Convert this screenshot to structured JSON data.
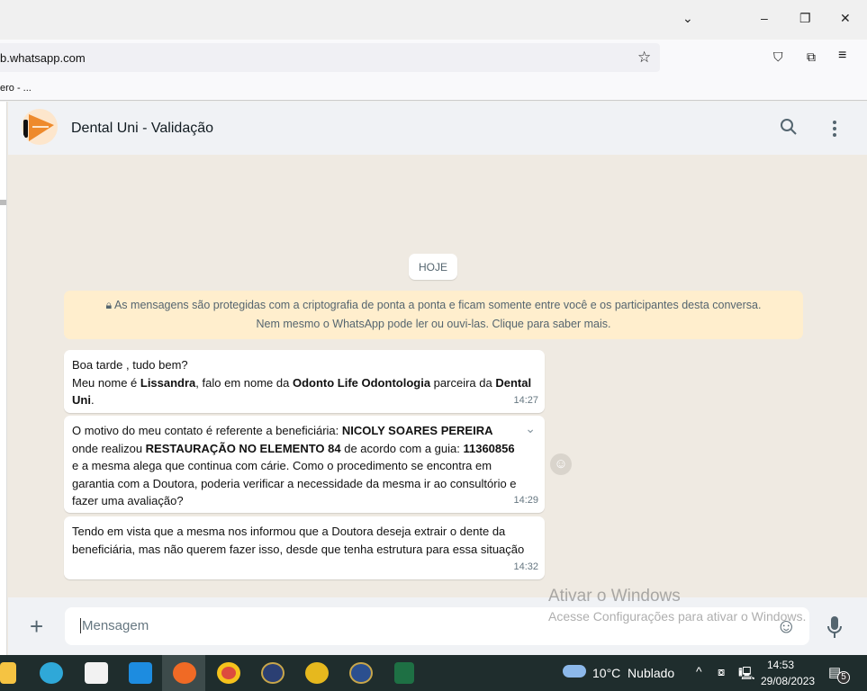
{
  "browser": {
    "url": "b.whatsapp.com",
    "bookmark": "ero - ..."
  },
  "chat": {
    "name": "Dental Uni - Validação",
    "date_label": "HOJE",
    "encryption_line1": "As mensagens são protegidas com a criptografia de ponta a ponta e ficam somente entre você e os participantes desta conversa.",
    "encryption_line2": "Nem mesmo o WhatsApp pode ler ou ouvi-las. Clique para saber mais.",
    "messages": [
      {
        "time": "14:27",
        "p1": "Boa tarde , tudo bem?",
        "p2a": "Meu nome é ",
        "p2b": "Lissandra",
        "p2c": ", falo em nome da ",
        "p2d": "Odonto Life Odontologia",
        "p2e": " parceira da ",
        "p2f": "Dental Uni",
        "p2g": "."
      },
      {
        "time": "14:29",
        "a": "O motivo do meu contato é referente a beneficiária: ",
        "b": "NICOLY SOARES PEREIRA",
        "c": " onde realizou ",
        "d": "RESTAURAÇÃO NO ELEMENTO 84",
        "e": " de acordo com a guia: ",
        "f": "11360856",
        "g": " e a mesma alega que continua com cárie. Como o procedimento se encontra em garantia com a Doutora, poderia verificar a necessidade da mesma ir ao consultório e fazer uma avaliação?"
      },
      {
        "time": "14:32",
        "text": "Tendo em vista que a mesma nos informou que a Doutora deseja extrair o dente da beneficiária, mas não querem fazer isso, desde que tenha estrutura para essa situação"
      }
    ],
    "input_placeholder": "Mensagem"
  },
  "watermark": {
    "title": "Ativar o Windows",
    "subtitle": "Acesse Configurações para ativar o Windows."
  },
  "taskbar": {
    "weather": "10°C  Nublado",
    "time": "14:53",
    "date": "29/08/2023",
    "notifications": "5"
  }
}
